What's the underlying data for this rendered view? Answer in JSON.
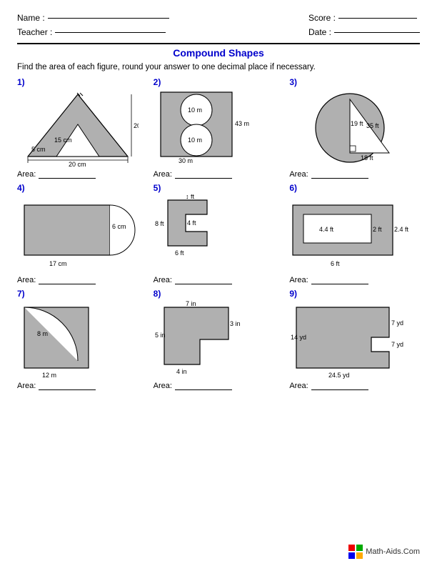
{
  "header": {
    "name_label": "Name :",
    "teacher_label": "Teacher :",
    "score_label": "Score :",
    "date_label": "Date :"
  },
  "title": "Compound Shapes",
  "instructions": "Find the area of each figure, round your answer to one decimal place if necessary.",
  "problems": [
    {
      "num": "1)"
    },
    {
      "num": "2)"
    },
    {
      "num": "3)"
    },
    {
      "num": "4)"
    },
    {
      "num": "5)"
    },
    {
      "num": "6)"
    },
    {
      "num": "7)"
    },
    {
      "num": "8)"
    },
    {
      "num": "9)"
    }
  ],
  "area_label": "Area:",
  "footer": "Math-Aids.Com"
}
